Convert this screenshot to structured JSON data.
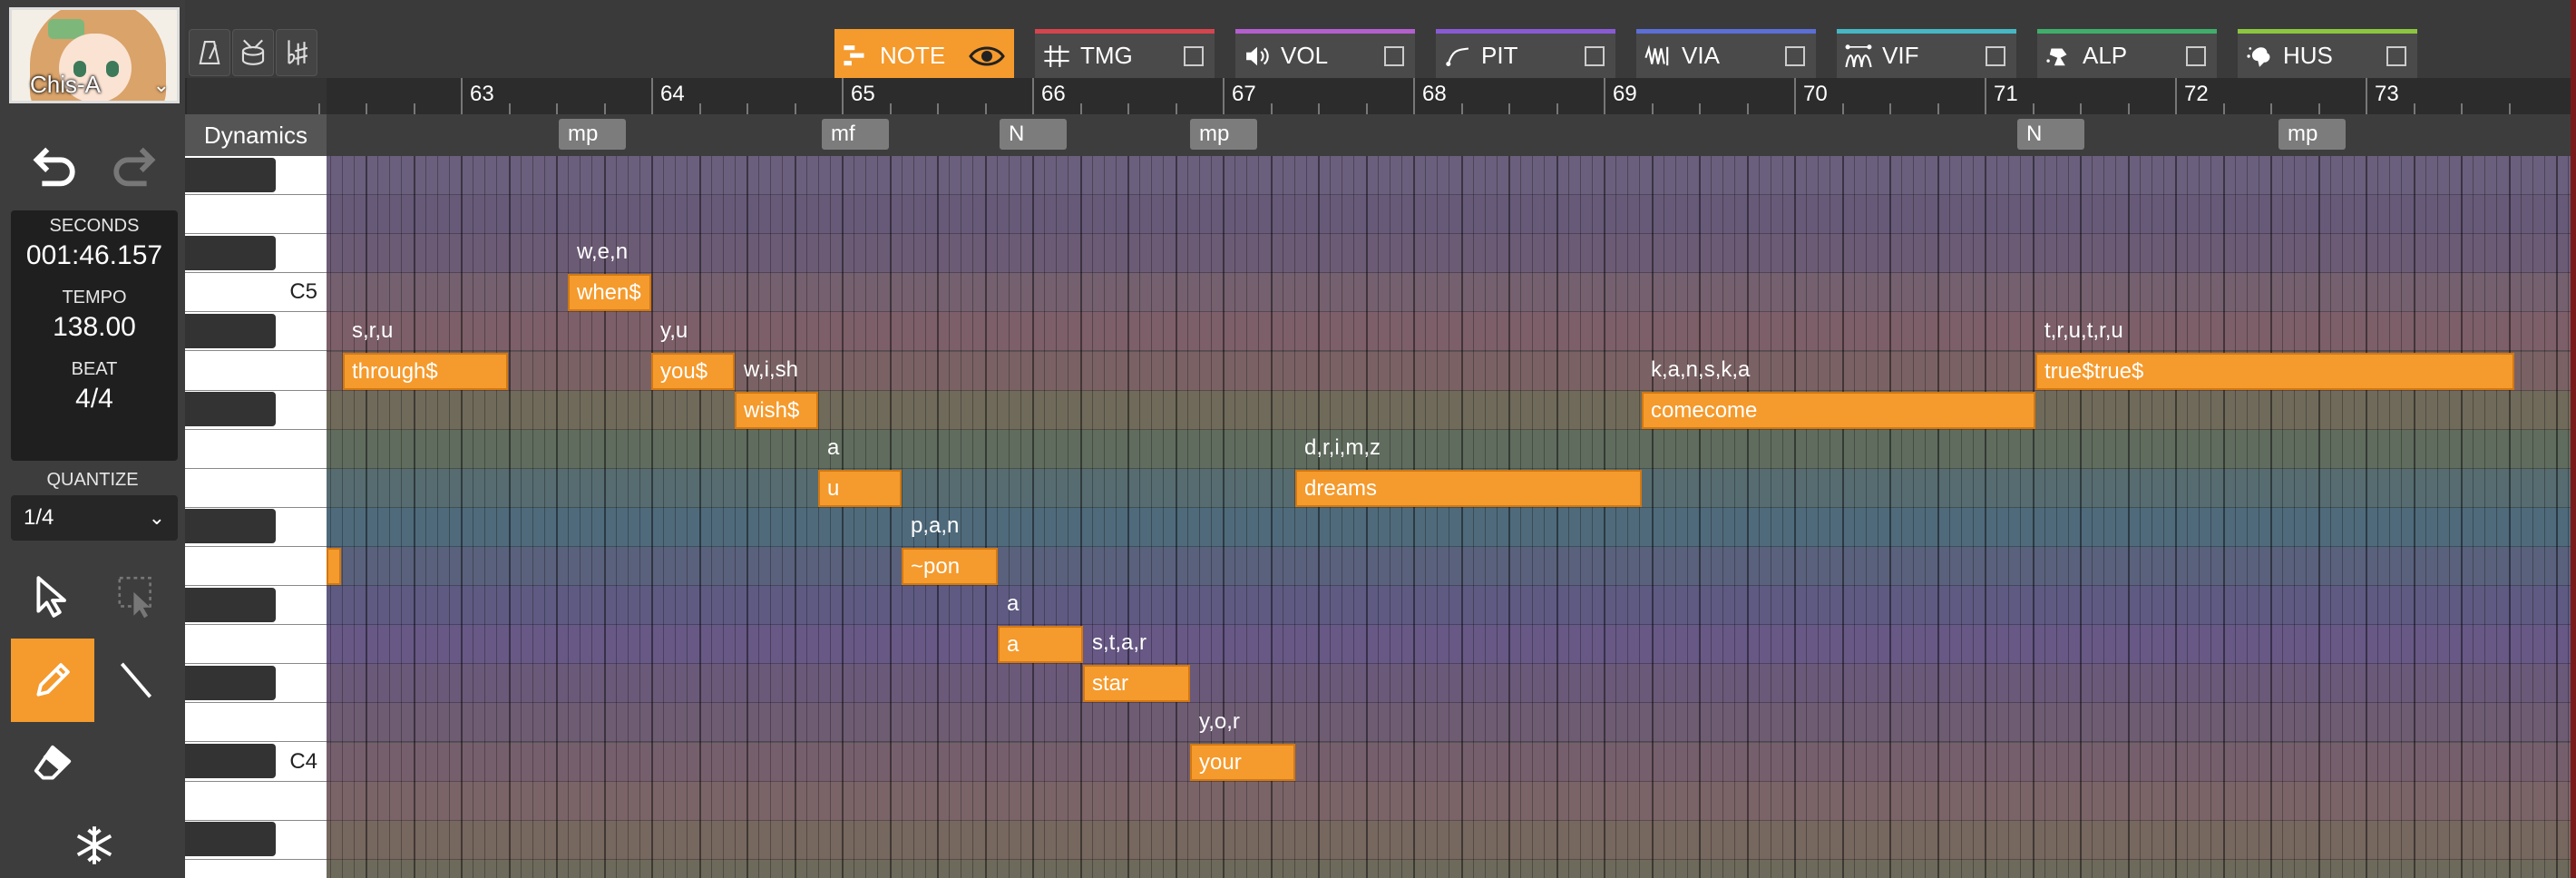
{
  "singer": {
    "name": "Chis-A"
  },
  "status": {
    "seconds_label": "SECONDS",
    "seconds": "001:46.157",
    "tempo_label": "TEMPO",
    "tempo": "138.00",
    "beat_label": "BEAT",
    "beat": "4/4"
  },
  "quantize": {
    "label": "QUANTIZE",
    "value": "1/4"
  },
  "tabs": [
    {
      "label": "NOTE",
      "color": "#f59a2c",
      "icon": "note-tab-icon"
    },
    {
      "label": "TMG",
      "color": "#d6444e",
      "icon": "timing-icon"
    },
    {
      "label": "VOL",
      "color": "#b35fd0",
      "icon": "volume-icon"
    },
    {
      "label": "PIT",
      "color": "#8a5ad6",
      "icon": "pitch-icon"
    },
    {
      "label": "VIA",
      "color": "#5b6fd6",
      "icon": "vibrato-amplitude-icon"
    },
    {
      "label": "VIF",
      "color": "#45b8c4",
      "icon": "vibrato-frequency-icon"
    },
    {
      "label": "ALP",
      "color": "#3fae6a",
      "icon": "alpha-icon"
    },
    {
      "label": "HUS",
      "color": "#8cc63f",
      "icon": "husky-icon"
    }
  ],
  "ruler": {
    "measures": [
      "63",
      "64",
      "65",
      "66",
      "67",
      "68",
      "69",
      "70",
      "71",
      "72",
      "73"
    ]
  },
  "dynamics": {
    "label": "Dynamics",
    "marks": [
      "mp",
      "mf",
      "N",
      "mp",
      "N",
      "mp"
    ]
  },
  "keys": {
    "c5": "C5",
    "c4": "C4"
  },
  "notes": [
    {
      "lyric": "when$",
      "phonemes": "w,e,n"
    },
    {
      "lyric": "through$",
      "phonemes": "s,r,u"
    },
    {
      "lyric": "you$",
      "phonemes": "y,u"
    },
    {
      "lyric": "wish$",
      "phonemes": "w,i,sh"
    },
    {
      "lyric": "u",
      "phonemes": "a"
    },
    {
      "lyric": "~pon",
      "phonemes": "p,a,n"
    },
    {
      "lyric": "a",
      "phonemes": "a"
    },
    {
      "lyric": "star",
      "phonemes": "s,t,a,r"
    },
    {
      "lyric": "your",
      "phonemes": "y,o,r"
    },
    {
      "lyric": "dreams",
      "phonemes": "d,r,i,m,z"
    },
    {
      "lyric": "comecome",
      "phonemes": "k,a,n,s,k,a"
    },
    {
      "lyric": "true$true$",
      "phonemes": "t,r,u,t,r,u"
    }
  ],
  "colors": {
    "accent": "#f59a2c",
    "note_border": "#d27812"
  }
}
